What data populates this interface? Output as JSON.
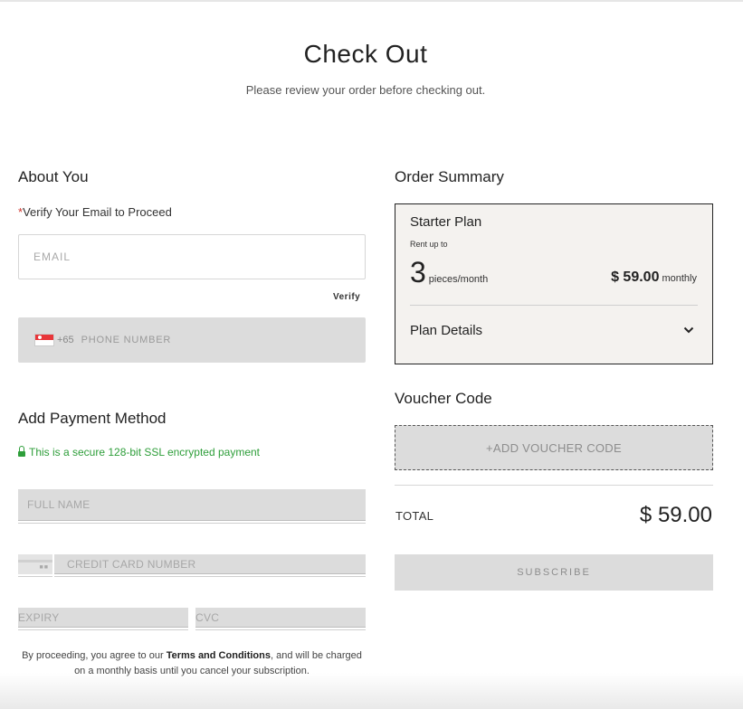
{
  "header": {
    "title": "Check Out",
    "subtitle": "Please review your order before checking out."
  },
  "about": {
    "heading": "About You",
    "required_mark": "*",
    "instruction": "Verify Your Email to Proceed",
    "email_placeholder": "EMAIL",
    "verify_label": "Verify",
    "phone_code": "+65",
    "phone_placeholder": "PHONE NUMBER"
  },
  "payment": {
    "heading": "Add Payment Method",
    "secure_note": "This is a secure 128-bit SSL encrypted payment",
    "fullname_placeholder": "FULL NAME",
    "card_placeholder": "CREDIT CARD NUMBER",
    "expiry_placeholder": "EXPIRY",
    "cvc_placeholder": "CVC"
  },
  "legal": {
    "prefix": "By proceeding, you agree to our ",
    "link": "Terms and Conditions",
    "suffix": ", and will be charged on a monthly basis until you cancel your subscription."
  },
  "summary": {
    "heading": "Order Summary",
    "plan_name": "Starter Plan",
    "rent_label": "Rent up to",
    "pieces_count": "3",
    "pieces_unit": "pieces/month",
    "price": "$ 59.00",
    "period": "monthly",
    "details_label": "Plan Details"
  },
  "voucher": {
    "heading": "Voucher Code",
    "button_label": "+ADD VOUCHER CODE"
  },
  "total": {
    "label": "TOTAL",
    "value": "$ 59.00"
  },
  "subscribe_label": "SUBSCRIBE",
  "icons": {
    "flag": "singapore-flag-icon",
    "lock": "lock-icon",
    "card": "credit-card-icon",
    "chevron": "chevron-down-icon"
  },
  "colors": {
    "secure_green": "#2e9e3a",
    "required_red": "#d0342c",
    "summary_bg": "#f4f2ef",
    "disabled_bg": "#dcdcdc"
  }
}
